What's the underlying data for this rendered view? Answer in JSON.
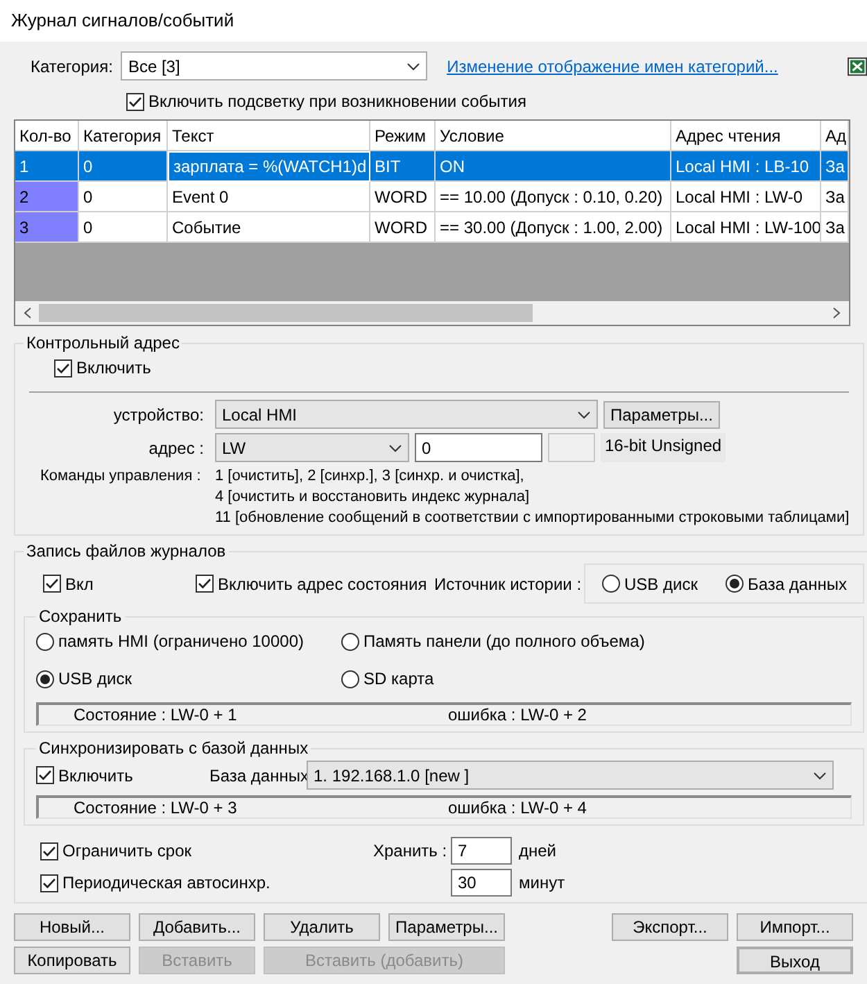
{
  "window": {
    "title": "Журнал сигналов/событий"
  },
  "category": {
    "label": "Категория:",
    "value": "Все [3]"
  },
  "category_link": "Изменение отображение имен категорий...",
  "highlight": {
    "label": "Включить подсветку при возникновении события",
    "checked": true
  },
  "table": {
    "columns": [
      "Кол-во",
      "Категория",
      "Текст",
      "Режим",
      "Условие",
      "Адрес чтения",
      "Ад"
    ],
    "rows": [
      {
        "selected": true,
        "marked": false,
        "cells": [
          "1",
          "0",
          "зарплата = %(WATCH1)d",
          "BIT",
          "ON",
          "Local HMI : LB-10",
          "За"
        ]
      },
      {
        "selected": false,
        "marked": true,
        "cells": [
          "2",
          "0",
          "Event 0",
          "WORD",
          "==  10.00 (Допуск :  0.10,  0.20)",
          "Local HMI : LW-0",
          "За"
        ]
      },
      {
        "selected": false,
        "marked": true,
        "cells": [
          "3",
          "0",
          "Событие",
          "WORD",
          "==  30.00 (Допуск :  1.00,  2.00)",
          "Local HMI : LW-100",
          "За"
        ]
      }
    ]
  },
  "control_address": {
    "title": "Контрольный адрес",
    "enable": {
      "label": "Включить",
      "checked": true
    },
    "device_label": "устройство:",
    "device_value": "Local HMI",
    "params_button": "Параметры...",
    "address_label": "адрес :",
    "address_type": "LW",
    "address_value": "0",
    "data_type": "16-bit Unsigned",
    "commands_label": "Команды управления :",
    "commands": [
      "1 [очистить], 2 [синхр.], 3 [синхр. и очистка],",
      "4 [очистить и восстановить индекс журнала]",
      "11 [обновление сообщений в соответствии с импортированными строковыми таблицами]"
    ]
  },
  "log_files": {
    "title": "Запись файлов журналов",
    "on": {
      "label": "Вкл",
      "checked": true
    },
    "status_address": {
      "label": "Включить адрес состояния",
      "checked": true
    },
    "history_source": {
      "label": "Источник истории :",
      "options": [
        {
          "label": "USB диск",
          "selected": false
        },
        {
          "label": "База данных",
          "selected": true
        }
      ]
    },
    "save": {
      "title": "Сохранить",
      "options": [
        {
          "label": "память HMI (ограничено 10000)",
          "selected": false
        },
        {
          "label": "Память панели (до полного объема)",
          "selected": false
        },
        {
          "label": "USB диск",
          "selected": true
        },
        {
          "label": "SD карта",
          "selected": false
        }
      ],
      "status": "Состояние : LW-0 + 1",
      "error": "ошибка : LW-0 + 2"
    },
    "sync": {
      "title": "Синхронизировать с базой данных",
      "enable": {
        "label": "Включить",
        "checked": true
      },
      "db_label": "База данных",
      "db_value": "1. 192.168.1.0 [new ]",
      "status": "Состояние : LW-0 + 3",
      "error": "ошибка : LW-0 + 4"
    },
    "limit": {
      "label": "Ограничить срок",
      "checked": true
    },
    "keep_label": "Хранить :",
    "keep_value": "7",
    "keep_unit": "дней",
    "periodic": {
      "label": "Периодическая автосинхр.",
      "checked": true
    },
    "period_value": "30",
    "period_unit": "минут"
  },
  "button_rows": [
    {
      "left": [
        {
          "label": "Новый...",
          "disabled": false,
          "wide": false
        },
        {
          "label": "Добавить...",
          "disabled": false,
          "wide": false
        },
        {
          "label": "Удалить",
          "disabled": false,
          "wide": false
        },
        {
          "label": "Параметры...",
          "disabled": false,
          "wide": false
        }
      ],
      "right": [
        {
          "label": "Экспорт...",
          "disabled": false,
          "default": false
        },
        {
          "label": "Импорт...",
          "disabled": false,
          "default": false
        }
      ]
    },
    {
      "left": [
        {
          "label": "Копировать",
          "disabled": false,
          "wide": false
        },
        {
          "label": "Вставить",
          "disabled": true,
          "wide": false
        },
        {
          "label": "Вставить (добавить)",
          "disabled": true,
          "wide": true
        }
      ],
      "right": [
        {
          "label": "Выход",
          "disabled": false,
          "default": true
        }
      ]
    }
  ]
}
